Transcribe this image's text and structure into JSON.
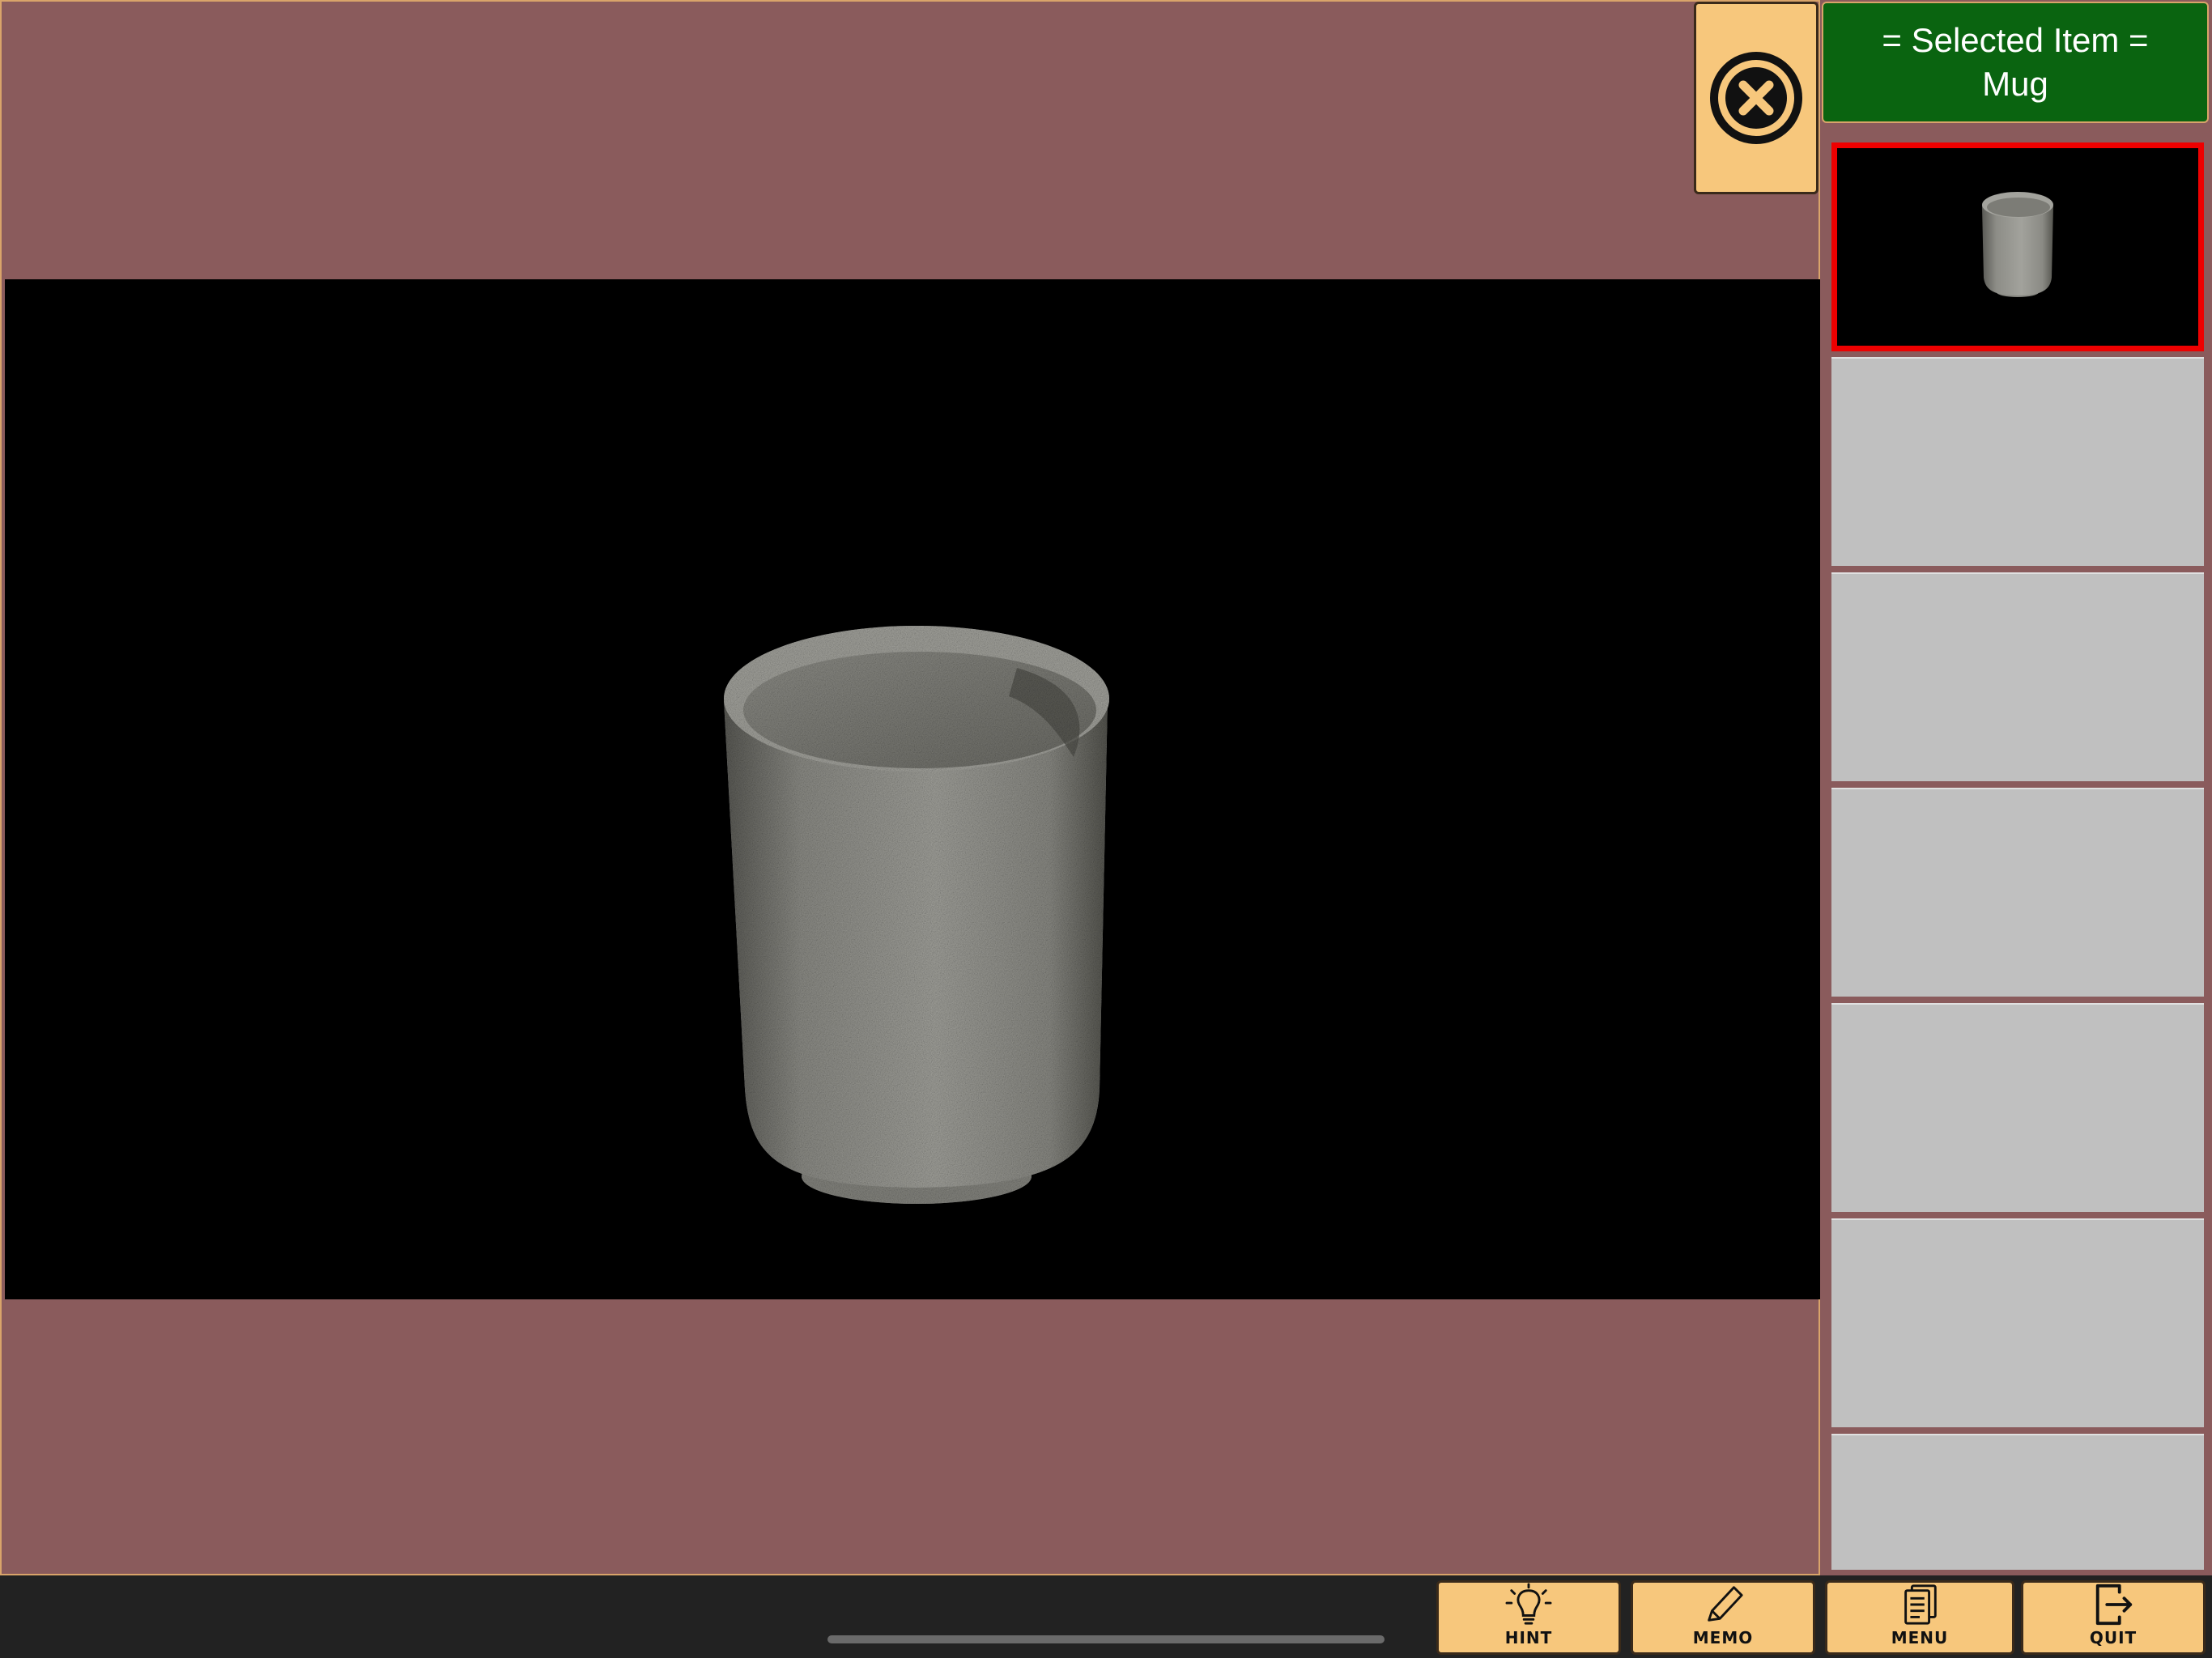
{
  "scene": {
    "item_name": "Mug",
    "colors": {
      "background": "#8a5b5c",
      "viewer": "#000000",
      "mug": "#9a9a94"
    }
  },
  "close_button": {
    "icon": "close-circle-icon"
  },
  "selected_item": {
    "header_label": "= Selected Item =",
    "item_name": "Mug"
  },
  "inventory": {
    "slots": [
      {
        "item": "Mug",
        "selected": true
      },
      {
        "item": "",
        "selected": false
      },
      {
        "item": "",
        "selected": false
      },
      {
        "item": "",
        "selected": false
      },
      {
        "item": "",
        "selected": false
      },
      {
        "item": "",
        "selected": false
      },
      {
        "item": "",
        "selected": false
      }
    ]
  },
  "toolbar": {
    "hint_label": "HINT",
    "memo_label": "MEMO",
    "menu_label": "MENU",
    "quit_label": "QUIT",
    "icons": [
      "lightbulb-icon",
      "pencil-icon",
      "document-icon",
      "exit-icon"
    ]
  },
  "colors": {
    "button_fill": "#f7c77c",
    "header_green": "#0a6410",
    "selection_red": "#ee0000",
    "empty_slot": "#c0c0c0"
  }
}
